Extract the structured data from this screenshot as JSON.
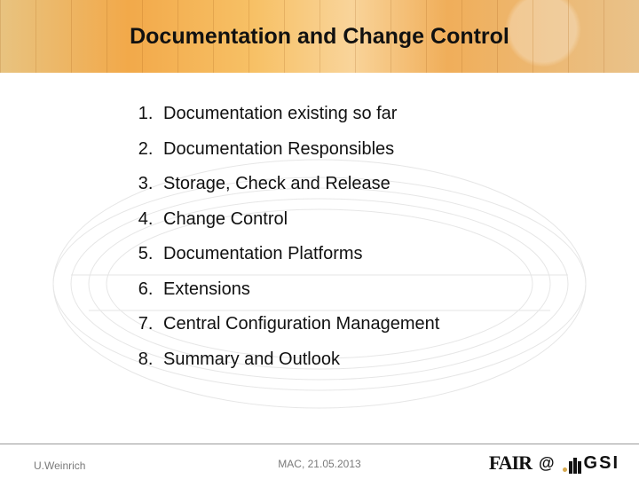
{
  "title": "Documentation and Change Control",
  "toc": [
    "Documentation existing so far",
    "Documentation Responsibles",
    "Storage, Check and Release",
    "Change Control",
    "Documentation Platforms",
    "Extensions",
    "Central Configuration Management",
    "Summary and Outlook"
  ],
  "footer": {
    "author": "U.Weinrich",
    "center": "MAC, 21.05.2013",
    "fair": "FAIR",
    "at": "@",
    "gsi": "GSI"
  }
}
